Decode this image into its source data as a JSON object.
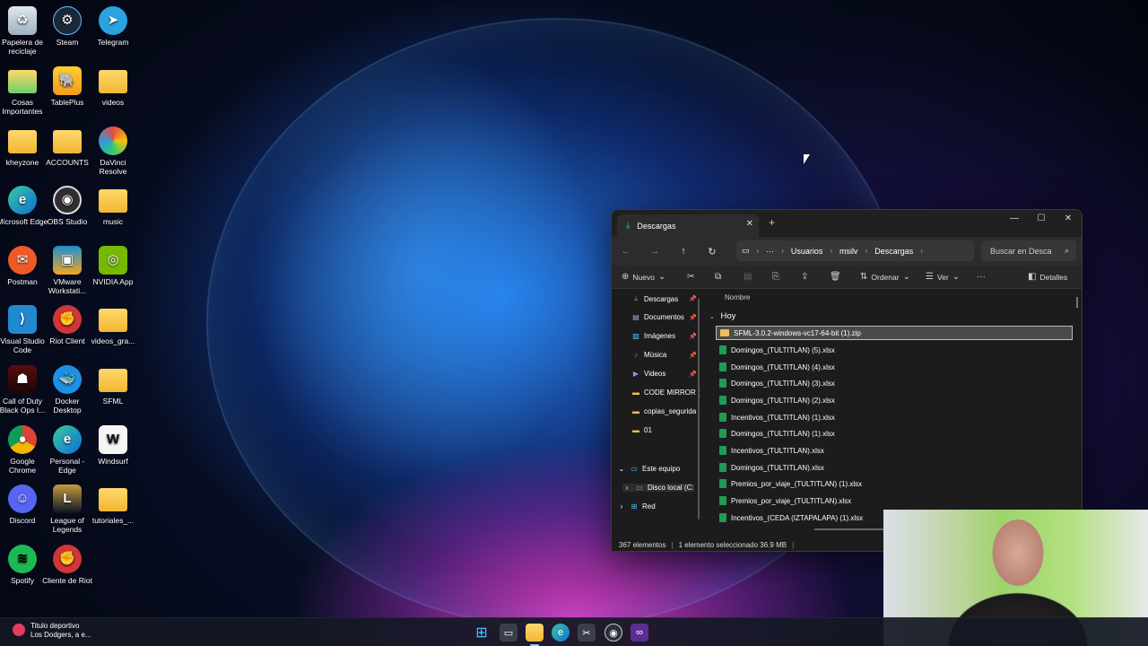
{
  "desktop": {
    "icons": [
      {
        "label": "Papelera de reciclaje"
      },
      {
        "label": "Steam"
      },
      {
        "label": "Telegram"
      },
      {
        "label": "Cosas Importantes"
      },
      {
        "label": "TablePlus"
      },
      {
        "label": "videos"
      },
      {
        "label": "kheyzone"
      },
      {
        "label": "ACCOUNTS"
      },
      {
        "label": "DaVinci Resolve"
      },
      {
        "label": "Microsoft Edge"
      },
      {
        "label": "OBS Studio"
      },
      {
        "label": "music"
      },
      {
        "label": "Postman"
      },
      {
        "label": "VMware Workstati..."
      },
      {
        "label": "NVIDIA App"
      },
      {
        "label": "Visual Studio Code"
      },
      {
        "label": "Riot Client"
      },
      {
        "label": "videos_gra..."
      },
      {
        "label": "Call of Duty Black Ops I..."
      },
      {
        "label": "Docker Desktop"
      },
      {
        "label": "SFML"
      },
      {
        "label": "Google Chrome"
      },
      {
        "label": "Personal - Edge"
      },
      {
        "label": "Windsurf"
      },
      {
        "label": "Discord"
      },
      {
        "label": "League of Legends"
      },
      {
        "label": "tutoriales_..."
      },
      {
        "label": "Spotify"
      },
      {
        "label": "Cliente de Riot"
      }
    ]
  },
  "explorer": {
    "tab_title": "Descargas",
    "breadcrumb": [
      "Usuarios",
      "msilv",
      "Descargas"
    ],
    "search_placeholder": "Buscar en Desca",
    "commands": {
      "new": "Nuevo",
      "sort": "Ordenar",
      "view": "Ver",
      "details": "Detalles"
    },
    "nav": {
      "quick": [
        {
          "label": "Descargas"
        },
        {
          "label": "Documentos"
        },
        {
          "label": "Imágenes"
        },
        {
          "label": "Música"
        },
        {
          "label": "Videos"
        },
        {
          "label": "CODE MIRROR ("
        },
        {
          "label": "copias_segurida"
        },
        {
          "label": "01"
        }
      ],
      "this_pc": "Este equipo",
      "local_disk": "Disco local (C:",
      "network": "Red"
    },
    "column_name": "Nombre",
    "group": "Hoy",
    "files": [
      "SFML-3.0.2-windows-vc17-64-bit (1).zip",
      "Domingos_(TULTITLAN) (5).xlsx",
      "Domingos_(TULTITLAN) (4).xlsx",
      "Domingos_(TULTITLAN) (3).xlsx",
      "Domingos_(TULTITLAN) (2).xlsx",
      "Incentivos_(TULTITLAN) (1).xlsx",
      "Domingos_(TULTITLAN) (1).xlsx",
      "Incentivos_(TULTITLAN).xlsx",
      "Domingos_(TULTITLAN).xlsx",
      "Premios_por_viaje_(TULTITLAN) (1).xlsx",
      "Premios_por_viaje_(TULTITLAN).xlsx",
      "Incentivos_(CEDA (IZTAPALAPA) (1).xlsx"
    ],
    "status": {
      "count": "367 elementos",
      "selected": "1 elemento seleccionado  36.9 MB"
    }
  },
  "taskbar": {
    "news_title": "Titulo deportivo",
    "news_sub": "Los Dodgers, a e..."
  },
  "colors": {
    "accent": "#4cc2ff",
    "explorer_bg": "#1c1c1c",
    "excel_green": "#1f9b53"
  }
}
